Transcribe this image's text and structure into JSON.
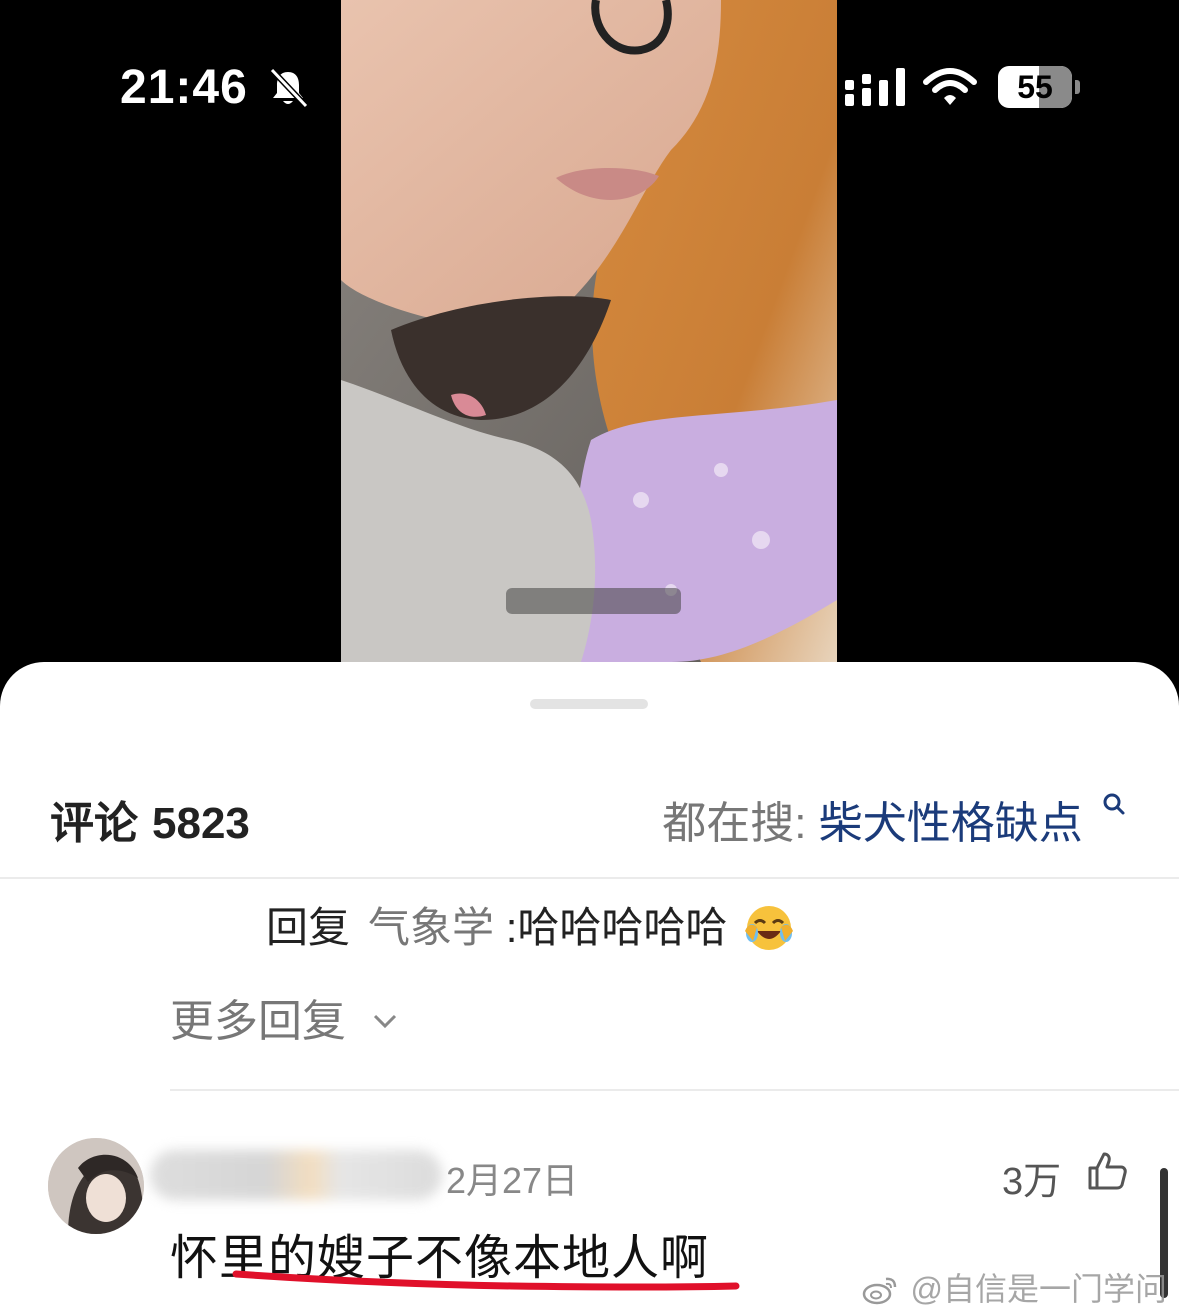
{
  "status_bar": {
    "time": "21:46",
    "battery": "55"
  },
  "header": {
    "comments_label": "评论",
    "comments_count": "5823",
    "search_prefix": "都在搜:",
    "search_topic": "柴犬性格缺点"
  },
  "reply": {
    "reply_word": "回复",
    "user": "气象学",
    "text": ":哈哈哈哈哈"
  },
  "more_replies": "更多回复",
  "comment": {
    "date": "2月27日",
    "likes": "3万",
    "text": "怀里的嫂子不像本地人啊"
  },
  "watermark": "@自信是一门学问",
  "colors": {
    "accent": "#1b3b7a",
    "underline": "#e0102a"
  }
}
